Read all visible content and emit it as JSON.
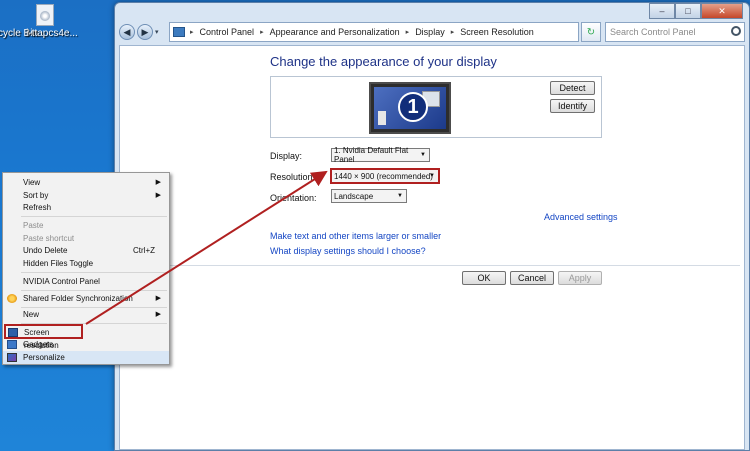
{
  "desktop": {
    "recycle_label": "cycle Bin",
    "file_label": "i-ttapcs4e..."
  },
  "window": {
    "buttons": {
      "minimize": "–",
      "maximize": "□",
      "close": "✕"
    },
    "address": {
      "crumbs": [
        "Control Panel",
        "Appearance and Personalization",
        "Display",
        "Screen Resolution"
      ],
      "separator": "▸",
      "dropdown_glyph": "▾",
      "refresh_glyph": "↻"
    },
    "search_placeholder": "Search Control Panel"
  },
  "display_settings": {
    "heading": "Change the appearance of your display",
    "monitor_number": "1",
    "detect_label": "Detect",
    "identify_label": "Identify",
    "display_label": "Display:",
    "display_value": "1. Nvidia Default Flat Panel",
    "resolution_label": "Resolution:",
    "resolution_value": "1440 × 900 (recommended)",
    "orientation_label": "Orientation:",
    "orientation_value": "Landscape",
    "advanced_link": "Advanced settings",
    "link_text_size": "Make text and other items larger or smaller",
    "link_which_settings": "What display settings should I choose?",
    "ok_label": "OK",
    "cancel_label": "Cancel",
    "apply_label": "Apply",
    "dropdown_arrow": "▼"
  },
  "context_menu": {
    "submenu_arrow": "▶",
    "items": [
      {
        "label": "View"
      },
      {
        "label": "Sort by"
      },
      {
        "label": "Refresh"
      },
      {
        "label": "Paste"
      },
      {
        "label": "Paste shortcut"
      },
      {
        "label": "Undo Delete",
        "shortcut": "Ctrl+Z"
      },
      {
        "label": "Hidden Files Toggle"
      },
      {
        "label": "NVIDIA Control Panel"
      },
      {
        "label": "Shared Folder Synchronization"
      },
      {
        "label": "New"
      },
      {
        "label": "Screen resolution"
      },
      {
        "label": "Gadgets"
      },
      {
        "label": "Personalize"
      }
    ]
  },
  "colors": {
    "annotation_red": "#b02020",
    "link_blue": "#1446c4",
    "heading_blue": "#1e3287"
  }
}
